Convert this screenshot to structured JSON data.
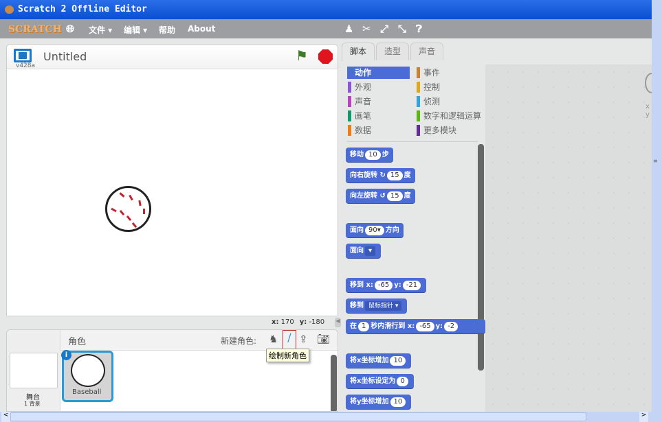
{
  "window": {
    "title": "Scratch 2 Offline Editor"
  },
  "menu": {
    "logo": "SCRATCH",
    "file": "文件 ▾",
    "edit": "编辑 ▾",
    "help": "帮助",
    "about": "About"
  },
  "stage": {
    "title": "Untitled",
    "version": "v428a",
    "coords_x_label": "x:",
    "coords_x": "170",
    "coords_y_label": "y:",
    "coords_y": "-180"
  },
  "sprites": {
    "header": "角色",
    "new_sprite": "新建角色:",
    "stage_label": "舞台",
    "backdrops": "1 背景",
    "sprite_name": "Baseball",
    "tooltip": "绘制新角色"
  },
  "tabs": [
    "脚本",
    "造型",
    "声音"
  ],
  "categories": [
    {
      "label": "动作",
      "color": "#4a6cd4"
    },
    {
      "label": "事件",
      "color": "#c88330"
    },
    {
      "label": "外观",
      "color": "#8a55d7"
    },
    {
      "label": "控制",
      "color": "#e1a91a"
    },
    {
      "label": "声音",
      "color": "#bb42c3"
    },
    {
      "label": "侦测",
      "color": "#2ca5e2"
    },
    {
      "label": "画笔",
      "color": "#0e9a6c"
    },
    {
      "label": "数字和逻辑运算",
      "color": "#5cb712"
    },
    {
      "label": "数据",
      "color": "#ee7d16"
    },
    {
      "label": "更多模块",
      "color": "#632d99"
    }
  ],
  "blocks": {
    "move": [
      "移动",
      "10",
      "步"
    ],
    "turn_right": [
      "向右旋转 ↻",
      "15",
      "度"
    ],
    "turn_left": [
      "向左旋转 ↺",
      "15",
      "度"
    ],
    "point_dir": [
      "面向",
      "90▾",
      "方向"
    ],
    "point_towards": [
      "面向",
      "▾"
    ],
    "goto_xy": [
      "移到 x:",
      "-65",
      "y:",
      "-21"
    ],
    "goto": [
      "移到",
      "鼠标指针 ▾"
    ],
    "glide": [
      "在",
      "1",
      "秒内滑行到 x:",
      "-65",
      "y:",
      "-2"
    ],
    "change_x": [
      "将x坐标增加",
      "10"
    ],
    "set_x": [
      "将x坐标设定为",
      "0"
    ],
    "change_y": [
      "将y坐标增加",
      "10"
    ]
  },
  "scripts": {
    "x_label": "x",
    "y_label": "y"
  }
}
